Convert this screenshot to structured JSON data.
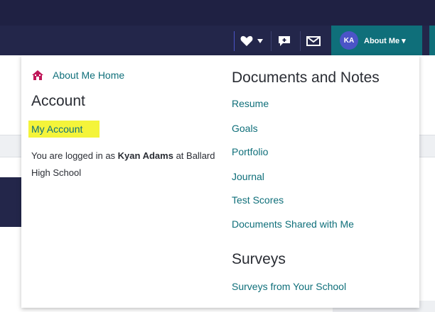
{
  "header": {
    "avatar_initials": "KA",
    "about_me_label": "About Me ▾",
    "accent_color": "#0f6f7a",
    "nav_bg": "#23264a"
  },
  "icons": {
    "favorites": "heart-icon",
    "favorites_dropdown": "caret-down-icon",
    "messages": "chat-icon",
    "mail": "mail-icon",
    "home": "home-icon"
  },
  "menu": {
    "home_link": "About Me Home",
    "account_heading": "Account",
    "my_account_link": "My Account",
    "logged_in_prefix": "You are logged in as ",
    "user_name": "Kyan Adams",
    "logged_in_suffix": " at Ballard High School",
    "documents_heading": "Documents and Notes",
    "documents_links": [
      "Resume",
      "Goals",
      "Portfolio",
      "Journal",
      "Test Scores",
      "Documents Shared with Me"
    ],
    "surveys_heading": "Surveys",
    "surveys_links": [
      "Surveys from Your School"
    ]
  }
}
